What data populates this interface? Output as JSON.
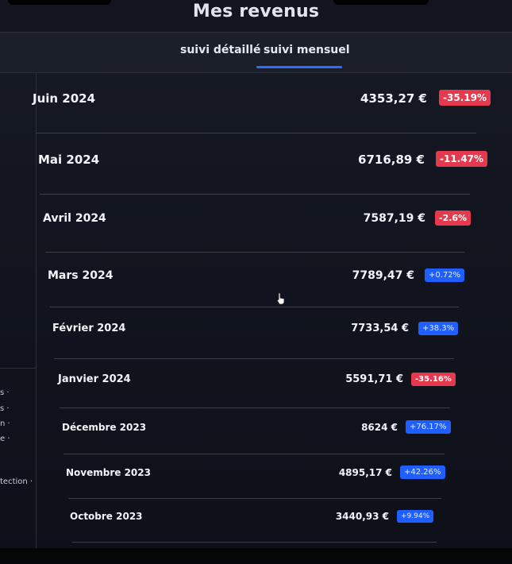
{
  "title": "Mes revenus",
  "tabs": [
    {
      "label": "suivi détaillé",
      "active": false
    },
    {
      "label": "suivi mensuel",
      "active": true
    }
  ],
  "accent_color": "#2f6bff",
  "negative_color": "#e53a4e",
  "positive_color": "#1f5fff",
  "side_items": [
    "s ·",
    "s ·",
    "n ·",
    "e ·",
    "tection ·"
  ],
  "months": [
    {
      "month": "Juin 2024",
      "amount": "4353,27 €",
      "change": "-35.19%",
      "trend": "negative"
    },
    {
      "month": "Mai 2024",
      "amount": "6716,89 €",
      "change": "-11.47%",
      "trend": "negative"
    },
    {
      "month": "Avril 2024",
      "amount": "7587,19 €",
      "change": "-2.6%",
      "trend": "negative"
    },
    {
      "month": "Mars 2024",
      "amount": "7789,47 €",
      "change": "+0.72%",
      "trend": "positive"
    },
    {
      "month": "Février 2024",
      "amount": "7733,54 €",
      "change": "+38.3%",
      "trend": "positive"
    },
    {
      "month": "Janvier 2024",
      "amount": "5591,71 €",
      "change": "-35.16%",
      "trend": "negative"
    },
    {
      "month": "Décembre 2023",
      "amount": "8624 €",
      "change": "+76.17%",
      "trend": "positive"
    },
    {
      "month": "Novembre 2023",
      "amount": "4895,17 €",
      "change": "+42.26%",
      "trend": "positive"
    },
    {
      "month": "Octobre 2023",
      "amount": "3440,93 €",
      "change": "+9.94%",
      "trend": "positive"
    }
  ]
}
